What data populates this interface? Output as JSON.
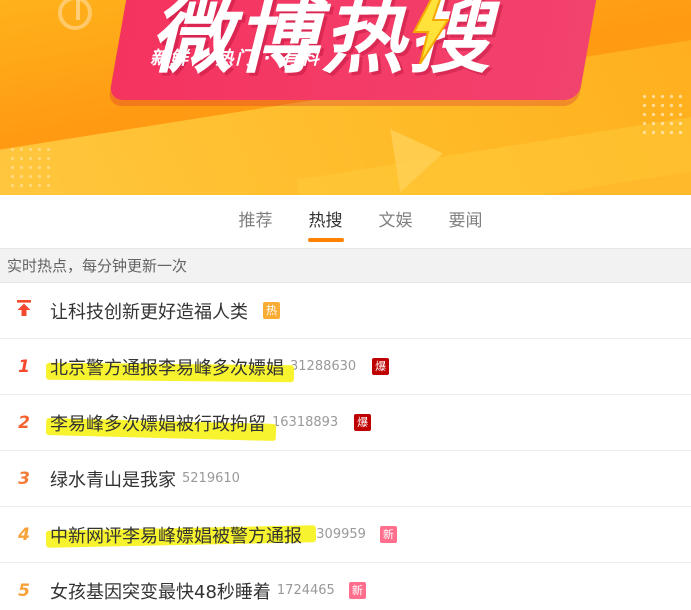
{
  "banner": {
    "title": "微博热搜",
    "slogan": "新鲜 · 热门 · 有料"
  },
  "tabs": [
    {
      "label": "推荐",
      "active": false
    },
    {
      "label": "热搜",
      "active": true
    },
    {
      "label": "文娱",
      "active": false
    },
    {
      "label": "要闻",
      "active": false
    }
  ],
  "info_bar": {
    "text": "实时热点，每分钟更新一次"
  },
  "hot_list": [
    {
      "rank": "",
      "rank_icon": "pin-top-icon",
      "title": "让科技创新更好造福人类",
      "count": "",
      "badge": "热",
      "badge_type": "hot",
      "highlighted": false
    },
    {
      "rank": "1",
      "title": "北京警方通报李易峰多次嫖娼",
      "count": "31288630",
      "badge": "爆",
      "badge_type": "bao",
      "highlighted": true
    },
    {
      "rank": "2",
      "title": "李易峰多次嫖娼被行政拘留",
      "count": "16318893",
      "badge": "爆",
      "badge_type": "bao",
      "highlighted": true
    },
    {
      "rank": "3",
      "title": "绿水青山是我家",
      "count": "5219610",
      "badge": "",
      "badge_type": "",
      "highlighted": false
    },
    {
      "rank": "4",
      "title": "中新网评李易峰嫖娼被警方通报",
      "count": "4309959",
      "badge": "新",
      "badge_type": "xin",
      "highlighted": true
    },
    {
      "rank": "5",
      "title": "女孩基因突变最快48秒睡着",
      "count": "1724465",
      "badge": "新",
      "badge_type": "xin",
      "highlighted": false
    }
  ],
  "colors": {
    "accent": "#ff8200",
    "hot_badge": "#f8ac33",
    "bao_badge": "#be0000",
    "new_badge": "#ff6e8c",
    "highlight": "#f7f32f"
  }
}
